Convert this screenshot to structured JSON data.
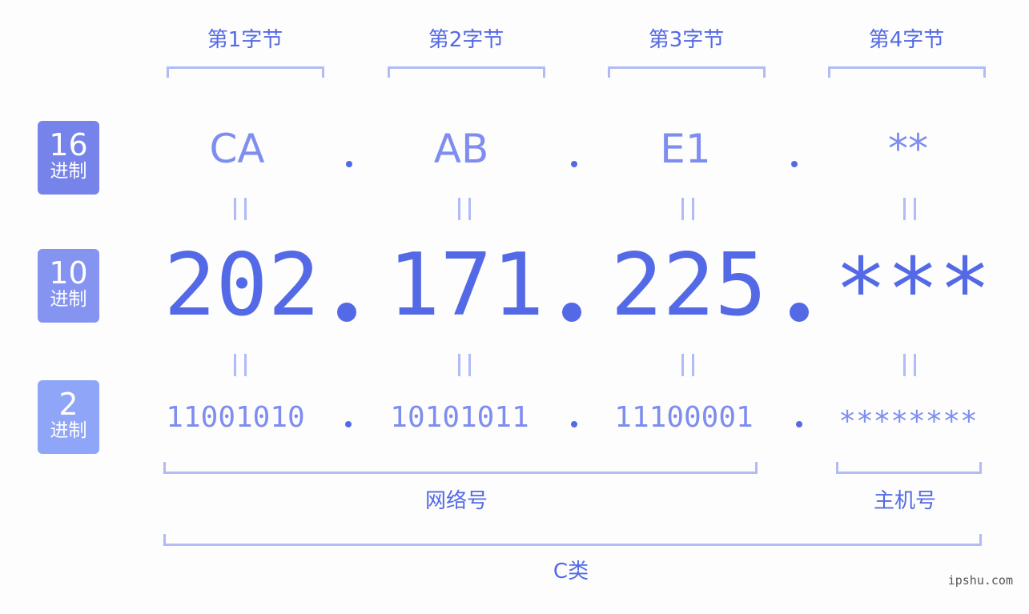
{
  "bytes": [
    {
      "label": "第1字节",
      "hex": "CA",
      "dec": "202",
      "bin": "11001010"
    },
    {
      "label": "第2字节",
      "hex": "AB",
      "dec": "171",
      "bin": "10101011"
    },
    {
      "label": "第3字节",
      "hex": "E1",
      "dec": "225",
      "bin": "11100001"
    },
    {
      "label": "第4字节",
      "hex": "**",
      "dec": "***",
      "bin": "********"
    }
  ],
  "separator": ".",
  "bases": [
    {
      "num": "16",
      "unit": "进制",
      "color": "#7583ea"
    },
    {
      "num": "10",
      "unit": "进制",
      "color": "#8594f0"
    },
    {
      "num": "2",
      "unit": "进制",
      "color": "#8fa5f8"
    }
  ],
  "groups": {
    "network": "网络号",
    "host": "主机号",
    "class": "C类"
  },
  "colors": {
    "accent": "#5469e6",
    "light": "#7e8def",
    "bracket": "#b1bbf6"
  },
  "watermark": "ipshu.com"
}
